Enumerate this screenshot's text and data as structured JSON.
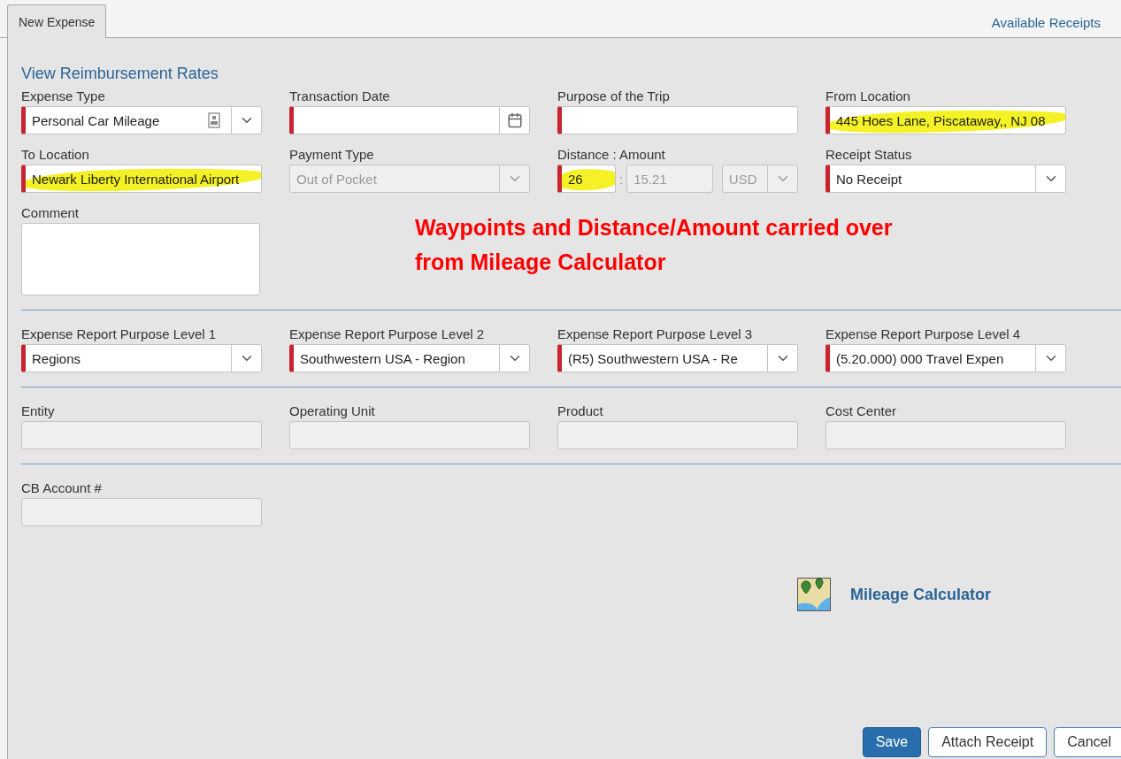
{
  "tabs": [
    {
      "label": "New Expense",
      "selected": true
    }
  ],
  "available_receipts": "Available Receipts",
  "rates_link": "View Reimbursement Rates",
  "sections": [
    {
      "fields": [
        {
          "label": "Expense Type",
          "kind": "select",
          "value": "Personal Car Mileage",
          "required": true,
          "disabled": false,
          "highlighted": false,
          "has_doc_icon": true
        },
        {
          "label": "Transaction Date",
          "kind": "date",
          "required": true,
          "disabled": false,
          "highlighted": false
        },
        {
          "label": "Purpose of the Trip",
          "kind": "text",
          "required": true,
          "disabled": false,
          "highlighted": false
        },
        {
          "label": "From Location",
          "kind": "text",
          "value": "445 Hoes Lane, Piscataway,, NJ 08",
          "required": true,
          "disabled": false,
          "highlighted": true
        },
        {
          "label": "To Location",
          "kind": "text",
          "value": "Newark Liberty International Airport",
          "required": true,
          "disabled": false,
          "highlighted": true
        },
        {
          "label": "Payment Type",
          "kind": "select",
          "value": "Out of Pocket",
          "required": false,
          "disabled": true,
          "highlighted": false
        },
        {
          "label": "Distance : Amount",
          "kind": "distance",
          "value": "26",
          "required": true,
          "disabled": false,
          "highlighted": true,
          "separator": ":",
          "amount": "15.21",
          "currency": "USD",
          "amount_disabled": true
        },
        {
          "label": "Receipt Status",
          "kind": "select",
          "value": "No Receipt",
          "required": true,
          "disabled": false,
          "highlighted": false
        },
        {
          "label": "Comment",
          "kind": "textarea",
          "required": false,
          "disabled": false,
          "highlighted": false
        }
      ],
      "annotation": [
        "Waypoints and Distance/Amount carried over",
        "from Mileage Calculator"
      ]
    },
    {
      "fields": [
        {
          "label": "Expense Report Purpose Level 1",
          "kind": "select",
          "value": "Regions",
          "required": true,
          "disabled": false,
          "highlighted": false
        },
        {
          "label": "Expense Report Purpose Level 2",
          "kind": "select",
          "value": "Southwestern USA - Region",
          "required": true,
          "disabled": false,
          "highlighted": false
        },
        {
          "label": "Expense Report Purpose Level 3",
          "kind": "select",
          "value": "(R5) Southwestern USA - Re",
          "required": true,
          "disabled": false,
          "highlighted": false
        },
        {
          "label": "Expense Report Purpose Level 4",
          "kind": "select",
          "value": "(5.20.000) 000 Travel Expen",
          "required": true,
          "disabled": false,
          "highlighted": false
        }
      ]
    },
    {
      "fields": [
        {
          "label": "Entity",
          "kind": "text",
          "required": false,
          "disabled": true,
          "highlighted": false
        },
        {
          "label": "Operating Unit",
          "kind": "text",
          "required": false,
          "disabled": true,
          "highlighted": false
        },
        {
          "label": "Product",
          "kind": "text",
          "required": false,
          "disabled": true,
          "highlighted": false
        },
        {
          "label": "Cost Center",
          "kind": "text",
          "required": false,
          "disabled": true,
          "highlighted": false
        }
      ]
    },
    {
      "fields": [
        {
          "label": "CB Account #",
          "kind": "text",
          "required": false,
          "disabled": true,
          "highlighted": false
        }
      ]
    }
  ],
  "mileage_link": "Mileage Calculator",
  "buttons": [
    {
      "label": "Save",
      "kind": "primary"
    },
    {
      "label": "Attach Receipt",
      "kind": "secondary"
    },
    {
      "label": "Cancel",
      "kind": "secondary"
    }
  ]
}
